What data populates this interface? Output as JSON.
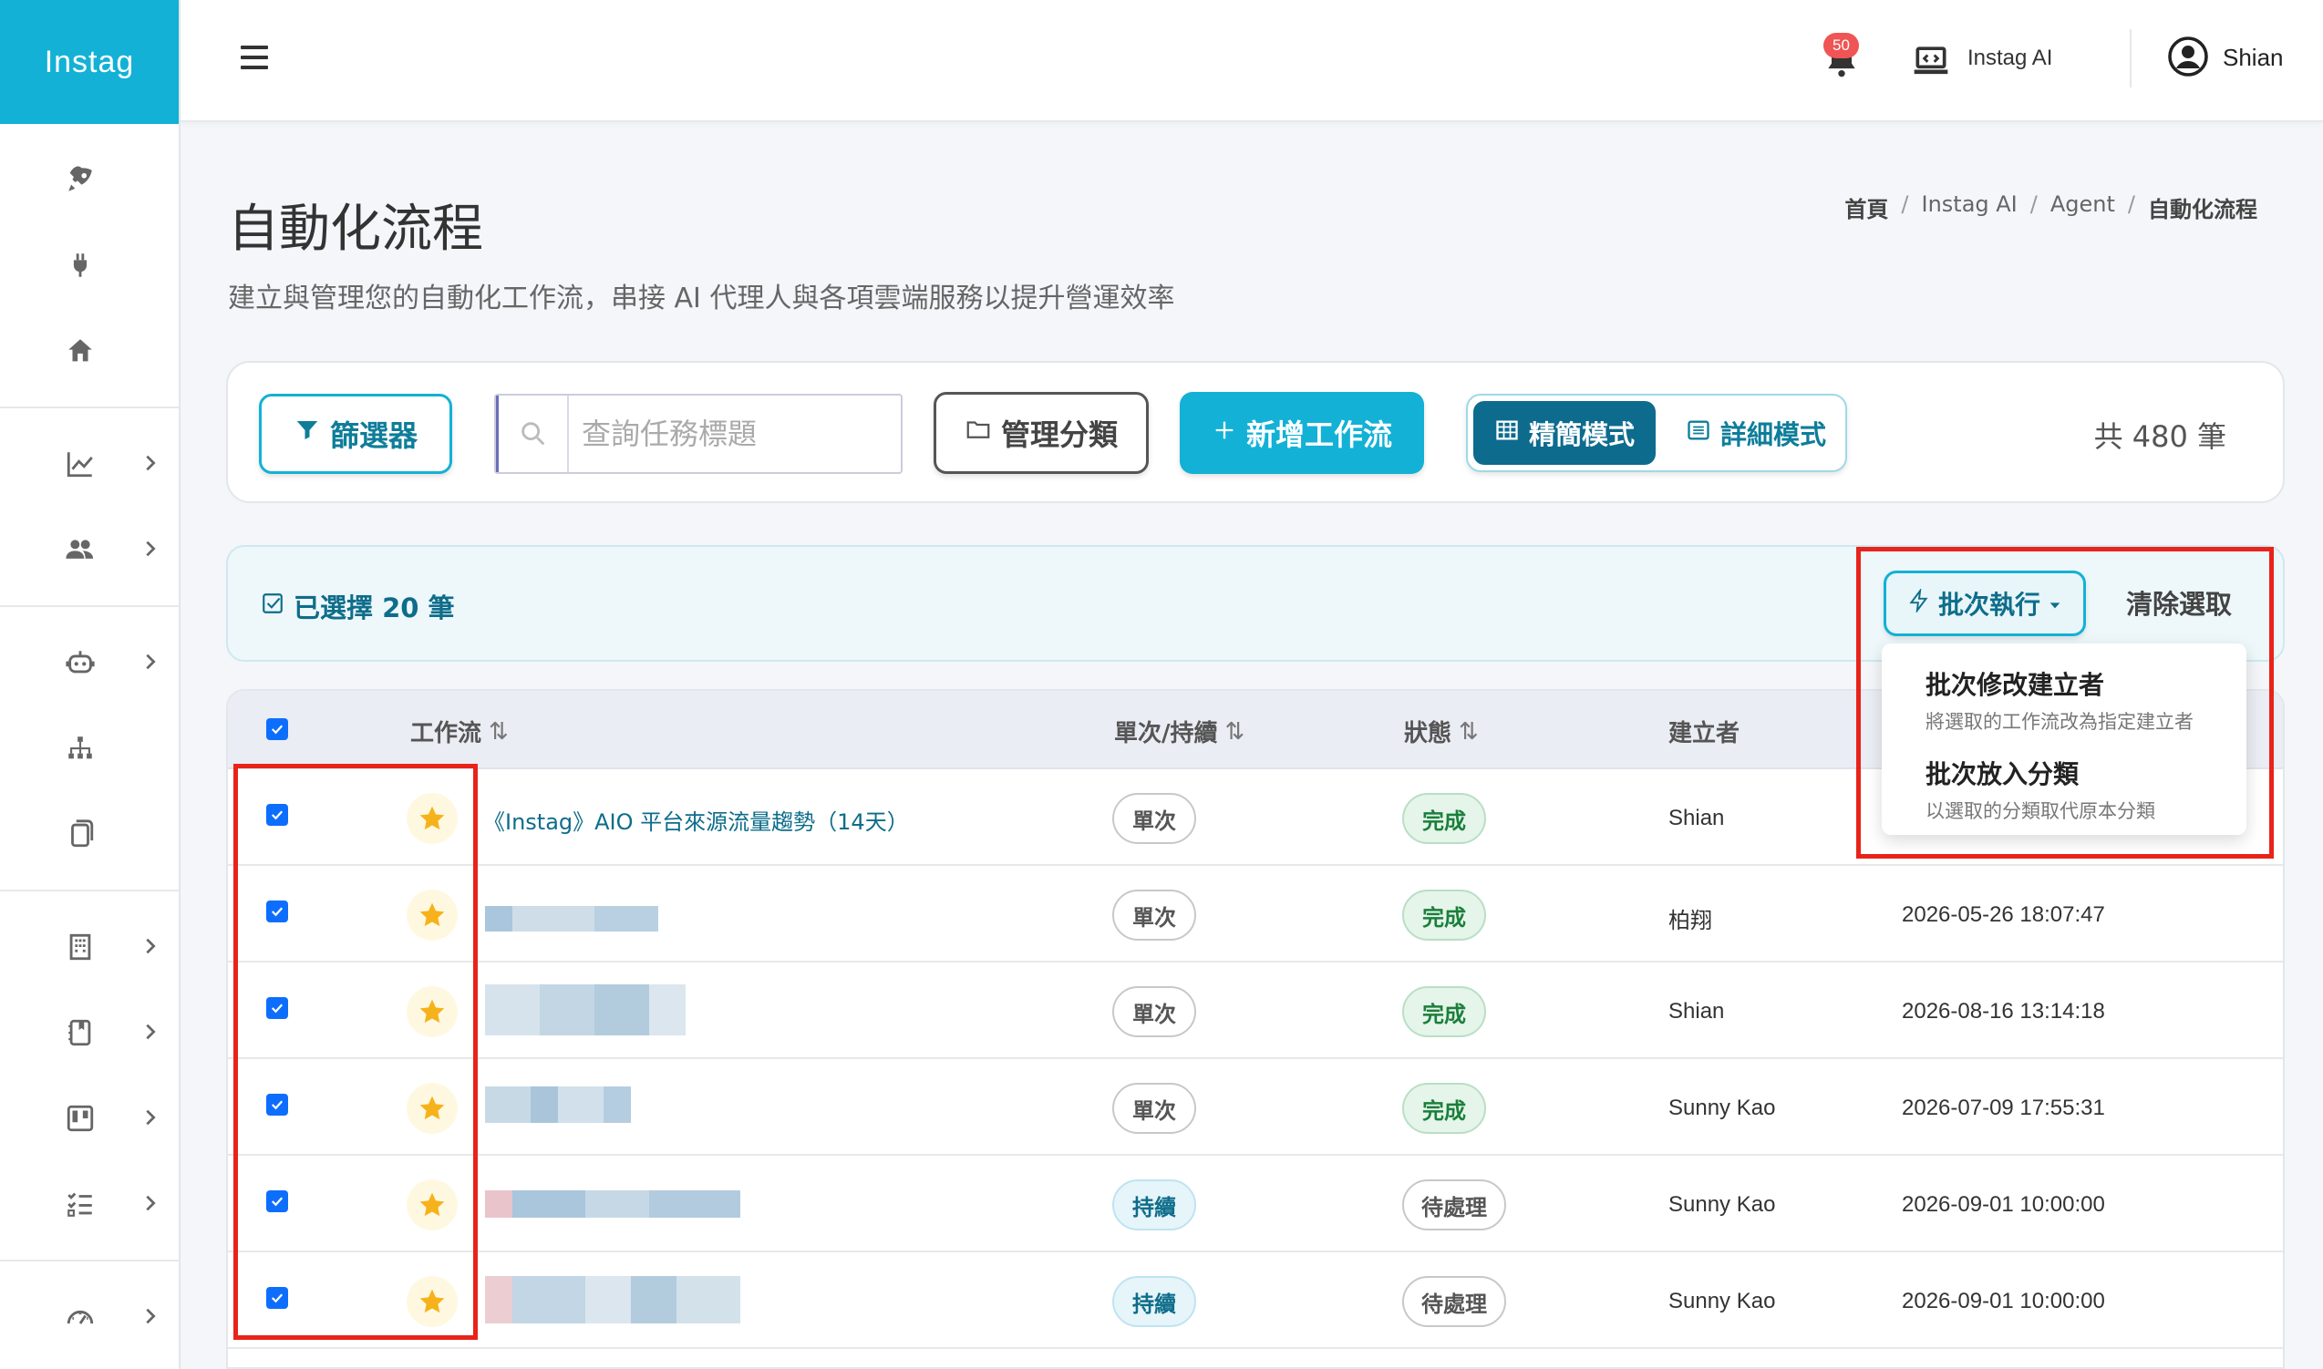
{
  "app": {
    "brand": "Instag"
  },
  "topbar": {
    "notification_count": "50",
    "ai_label": "Instag AI",
    "user_name": "Shian"
  },
  "sidebar": {
    "items": [
      {
        "icon": "rocket-icon",
        "has_chevron": false
      },
      {
        "icon": "plug-icon",
        "has_chevron": false
      },
      {
        "icon": "home-icon",
        "has_chevron": false
      },
      {
        "icon": "chart-line-icon",
        "has_chevron": true
      },
      {
        "icon": "users-icon",
        "has_chevron": true
      },
      {
        "icon": "robot-icon",
        "has_chevron": true
      },
      {
        "icon": "sitemap-icon",
        "has_chevron": false
      },
      {
        "icon": "copy-icon",
        "has_chevron": false
      },
      {
        "icon": "building-icon",
        "has_chevron": true
      },
      {
        "icon": "book-icon",
        "has_chevron": true
      },
      {
        "icon": "columns-icon",
        "has_chevron": true
      },
      {
        "icon": "checklist-icon",
        "has_chevron": true
      },
      {
        "icon": "gauge-icon",
        "has_chevron": true
      }
    ]
  },
  "header": {
    "title": "自動化流程",
    "subtitle": "建立與管理您的自動化工作流，串接 AI 代理人與各項雲端服務以提升營運效率",
    "breadcrumb": [
      "首頁",
      "Instag AI",
      "Agent",
      "自動化流程"
    ]
  },
  "toolbar": {
    "filter_label": "篩選器",
    "search_placeholder": "查詢任務標題",
    "category_label": "管理分類",
    "new_label": "新增工作流",
    "mode_simple": "精簡模式",
    "mode_detail": "詳細模式",
    "total": "共 480 筆"
  },
  "selection": {
    "label": "已選擇 20 筆",
    "batch_label": "批次執行",
    "clear_label": "清除選取"
  },
  "batch_menu": [
    {
      "title": "批次修改建立者",
      "desc": "將選取的工作流改為指定建立者"
    },
    {
      "title": "批次放入分類",
      "desc": "以選取的分類取代原本分類"
    }
  ],
  "table": {
    "columns": [
      "工作流",
      "單次/持續",
      "狀態",
      "建立者"
    ],
    "sort_icon": "⇅",
    "rows": [
      {
        "workflow": "《Instag》AIO 平台來源流量趨勢（14天）",
        "type": "單次",
        "status": "完成",
        "creator": "Shian",
        "date": ""
      },
      {
        "workflow": "",
        "type": "單次",
        "status": "完成",
        "creator": "柏翔",
        "date": "2026-05-26 18:07:47"
      },
      {
        "workflow": "",
        "type": "單次",
        "status": "完成",
        "creator": "Shian",
        "date": "2026-08-16 13:14:18"
      },
      {
        "workflow": "",
        "type": "單次",
        "status": "完成",
        "creator": "Sunny Kao",
        "date": "2026-07-09 17:55:31"
      },
      {
        "workflow": "",
        "type": "持續",
        "status": "待處理",
        "creator": "Sunny Kao",
        "date": "2026-09-01 10:00:00"
      },
      {
        "workflow": "",
        "type": "持續",
        "status": "待處理",
        "creator": "Sunny Kao",
        "date": "2026-09-01 10:00:00"
      }
    ]
  },
  "colors": {
    "brand": "#13b1d5",
    "primary_dark": "#0d6b8e",
    "highlight": "#e8231a"
  }
}
